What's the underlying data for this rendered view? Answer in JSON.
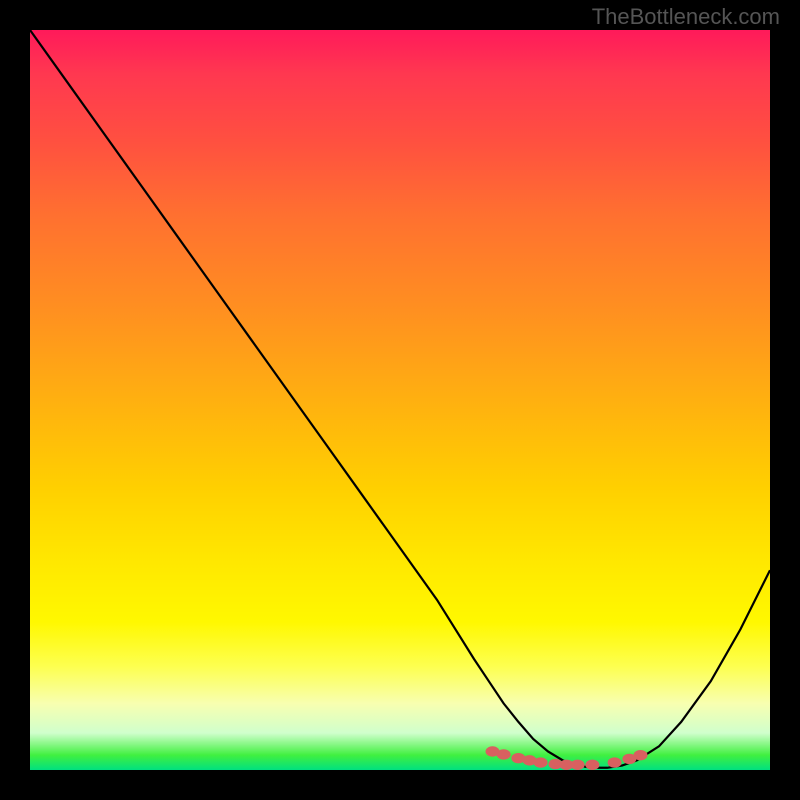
{
  "watermark": "TheBottleneck.com",
  "chart_data": {
    "type": "line",
    "title": "",
    "xlabel": "",
    "ylabel": "",
    "xlim": [
      0,
      100
    ],
    "ylim": [
      0,
      100
    ],
    "curve": {
      "x": [
        0,
        5,
        10,
        15,
        20,
        25,
        30,
        35,
        40,
        45,
        50,
        55,
        60,
        62,
        64,
        66,
        68,
        70,
        72,
        74,
        76,
        78,
        80,
        82,
        85,
        88,
        92,
        96,
        100
      ],
      "y": [
        100,
        93,
        86,
        79,
        72,
        65,
        58,
        51,
        44,
        37,
        30,
        23,
        15,
        12,
        9,
        6.5,
        4.2,
        2.5,
        1.3,
        0.6,
        0.3,
        0.3,
        0.6,
        1.3,
        3.2,
        6.5,
        12,
        19,
        27
      ]
    },
    "markers": {
      "x": [
        62.5,
        64,
        66,
        67.5,
        69,
        71,
        72.5,
        74,
        76,
        79,
        81,
        82.5
      ],
      "y": [
        2.5,
        2.1,
        1.6,
        1.3,
        1.0,
        0.8,
        0.7,
        0.7,
        0.7,
        1.0,
        1.5,
        2.0
      ]
    },
    "marker_color": "#d86060",
    "curve_color": "#000000"
  }
}
